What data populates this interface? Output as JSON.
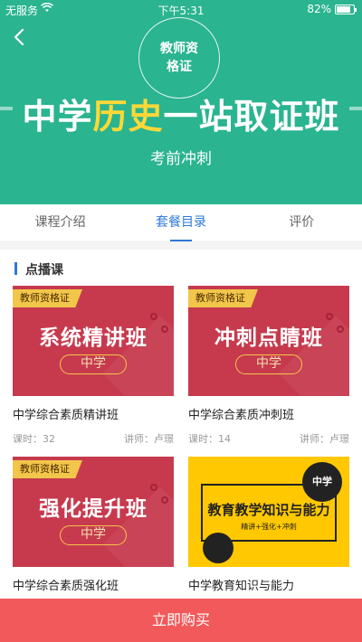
{
  "status_bar": {
    "carrier": "无服务",
    "time": "下午5:31",
    "battery": "82%"
  },
  "header": {
    "seal_line1": "教师资",
    "seal_line2": "格证",
    "title_part1": "中学",
    "title_highlight": "历史",
    "title_part2": "一站取证班",
    "subtitle": "考前冲刺"
  },
  "tabs": [
    {
      "label": "课程介绍"
    },
    {
      "label": "套餐目录"
    },
    {
      "label": "评价"
    }
  ],
  "section": {
    "title": "点播课"
  },
  "courses": [
    {
      "tag": "教师资格证",
      "thumb_name": "系统精讲班",
      "level": "中学",
      "title": "中学综合素质精讲班",
      "hours": "课时：32",
      "teacher": "讲师：卢璟"
    },
    {
      "tag": "教师资格证",
      "thumb_name": "冲刺点睛班",
      "level": "中学",
      "title": "中学综合素质冲刺班",
      "hours": "课时：14",
      "teacher": "讲师：卢璟"
    },
    {
      "tag": "教师资格证",
      "thumb_name": "强化提升班",
      "level": "中学",
      "title": "中学综合素质强化班",
      "hours": "",
      "teacher": ""
    },
    {
      "badge": "中学",
      "thumb_name": "教育教学知识与能力",
      "thumb_sub": "精讲+强化+冲刺",
      "title": "中学教育知识与能力",
      "hours": "",
      "teacher": ""
    }
  ],
  "buy_button": "立即购买"
}
